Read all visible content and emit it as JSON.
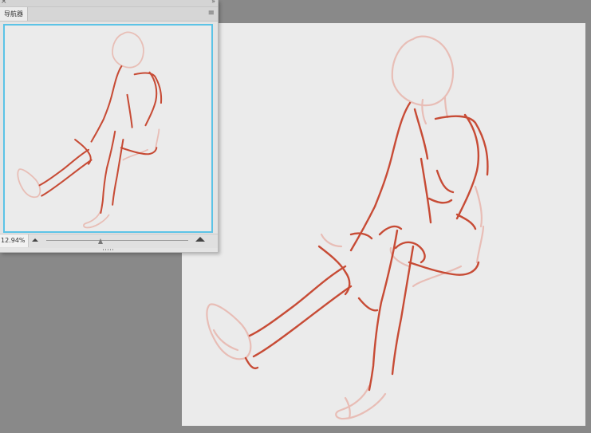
{
  "navigator": {
    "tab_label": "导航器",
    "zoom_value": "12.94%",
    "zoom_slider_fraction": 0.38,
    "close_glyph": "×",
    "collapse_glyph": "»",
    "menu_glyph": "≡"
  },
  "colors": {
    "workspace": "#898989",
    "canvas": "#ebebeb",
    "view_frame": "#5cc3e6",
    "sketch_light": "#e8b6ad",
    "sketch_dark": "#c43a22"
  },
  "icons": {
    "close": "close-icon",
    "collapse": "collapse-icon",
    "menu": "panel-menu-icon",
    "zoom_out": "zoom-out-icon",
    "zoom_in": "zoom-in-icon"
  }
}
